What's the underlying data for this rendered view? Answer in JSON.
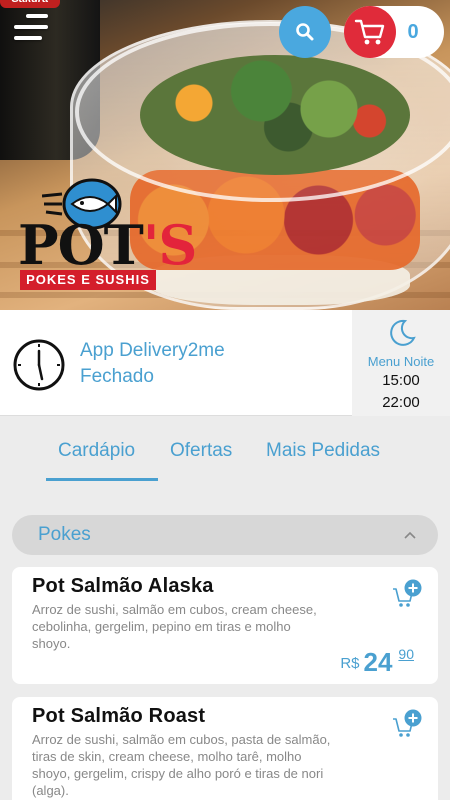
{
  "header": {
    "cart_count": "0",
    "icons": {
      "menu": "hamburger-icon",
      "search": "search-icon",
      "cart": "cart-icon"
    },
    "colors": {
      "search": "#4aa8df",
      "cart": "#e02b3a"
    }
  },
  "brand": {
    "logo_main_1": "POT",
    "logo_main_2": "'S",
    "logo_sub": "POKES E SUSHIS",
    "bottle_label": "Sakura"
  },
  "info": {
    "app_name": "App Delivery2me",
    "status": "Fechado",
    "menu_label": "Menu Noite",
    "open_time": "15:00",
    "close_time": "22:00"
  },
  "tabs": [
    {
      "label": "Cardápio",
      "active": true
    },
    {
      "label": "Ofertas",
      "active": false
    },
    {
      "label": "Mais Pedidas",
      "active": false
    }
  ],
  "category": {
    "label": "Pokes",
    "expanded": true
  },
  "items": [
    {
      "title": "Pot Salmão Alaska",
      "description": "Arroz de sushi, salmão em cubos, cream cheese, cebolinha, gergelim, pepino em tiras e molho shoyo.",
      "currency": "R$",
      "price_int": "24",
      "price_dec": "90"
    },
    {
      "title": "Pot Salmão Roast",
      "description": "Arroz de sushi, salmão em cubos, pasta de salmão, tiras de skin, cream cheese, molho tarê, molho shoyo, gergelim, crispy de alho poró e tiras de nori (alga)."
    }
  ],
  "accent_color": "#4aa0d0"
}
